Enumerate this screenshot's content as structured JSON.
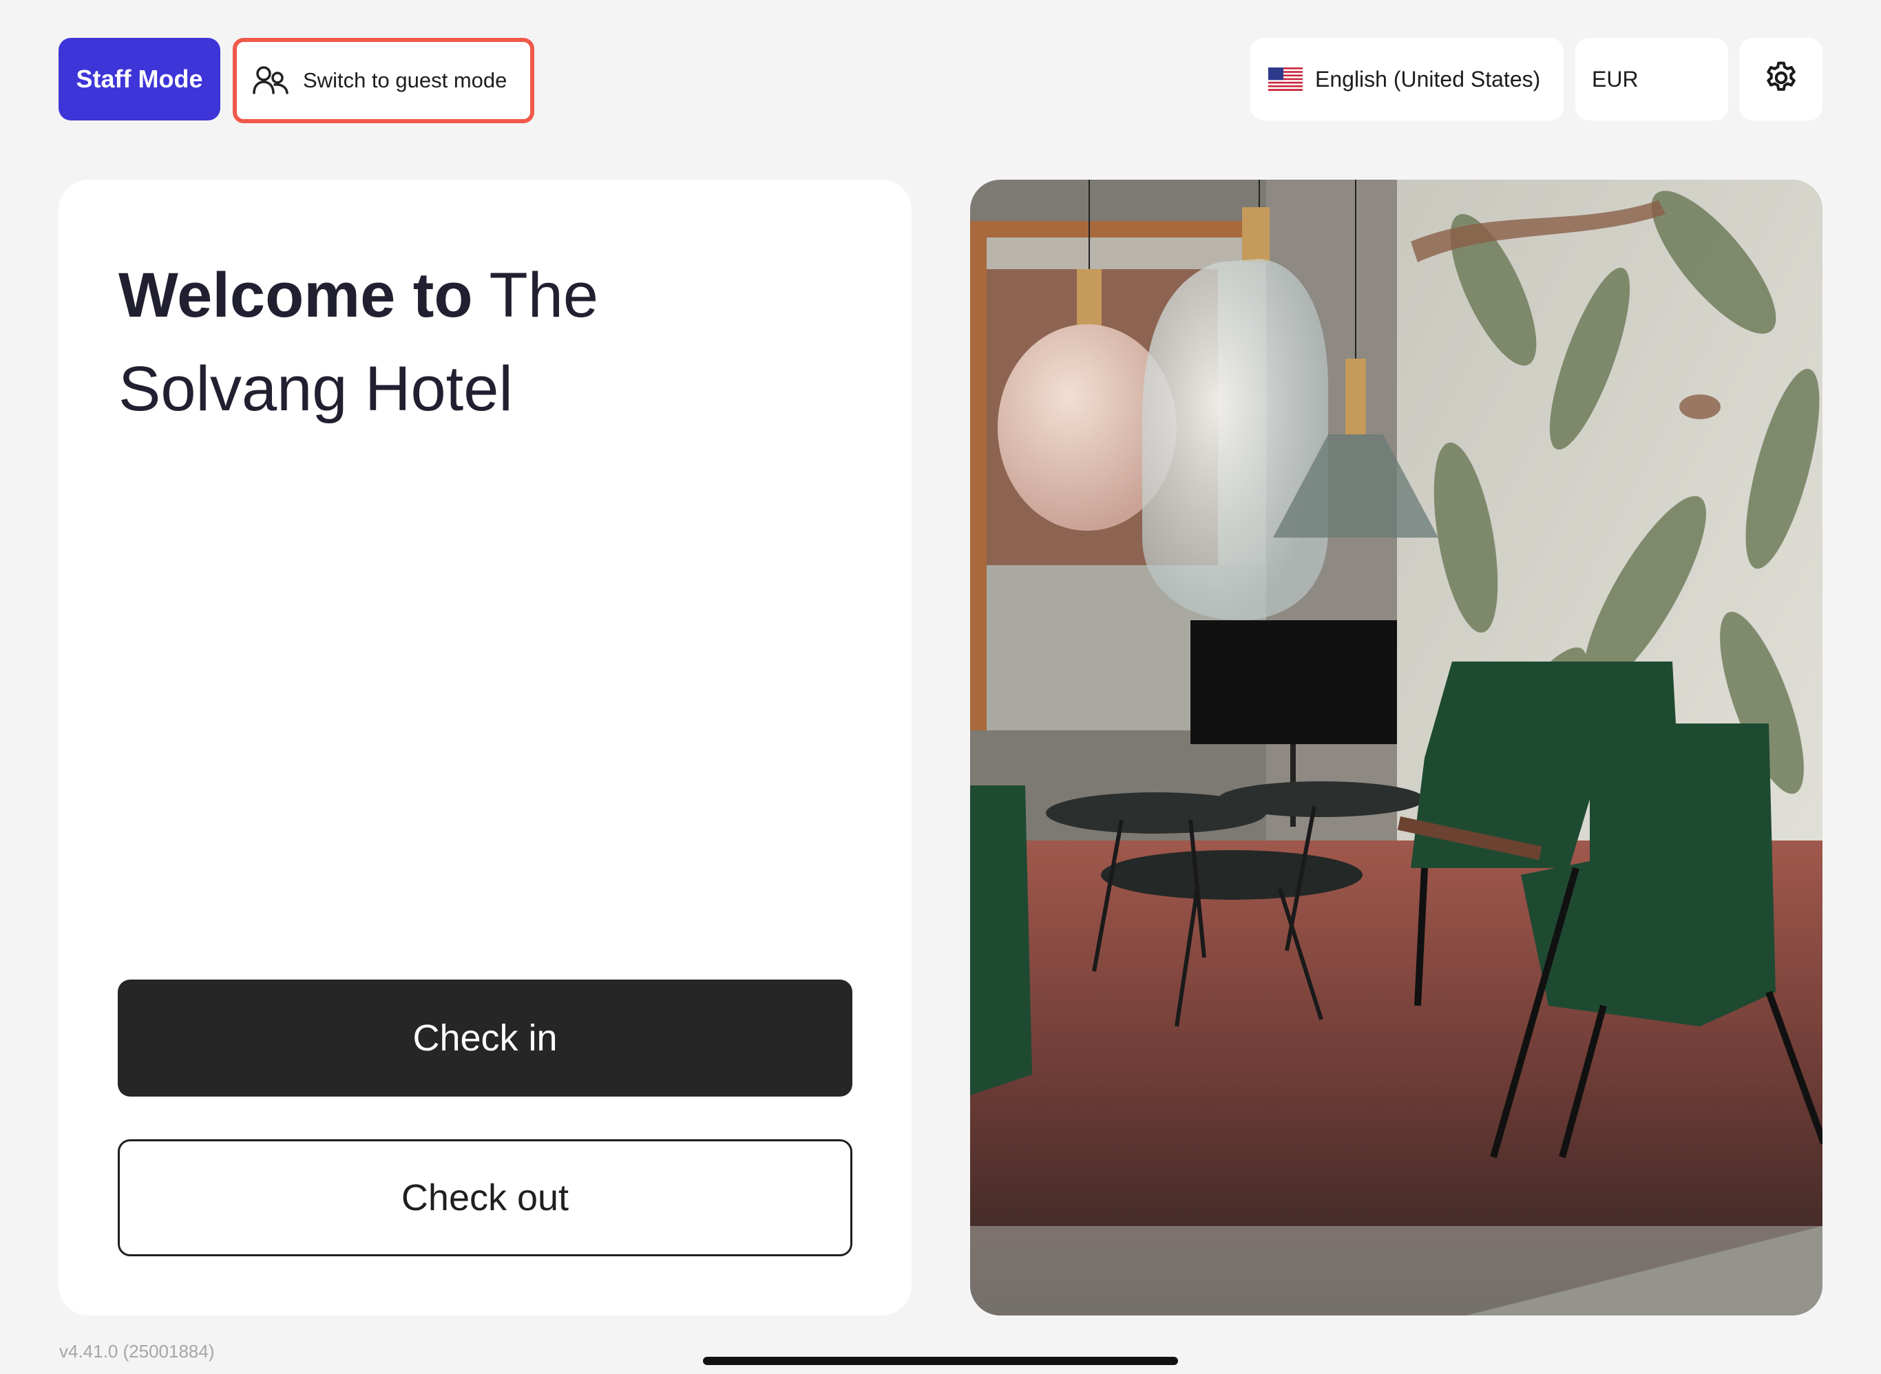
{
  "header": {
    "staff_mode_label": "Staff Mode",
    "switch_guest_label": "Switch to guest mode",
    "guest_icon": "users-icon",
    "language_label": "English (United States)",
    "language_flag": "us-flag-icon",
    "currency_label": "EUR",
    "settings_icon": "gear-icon"
  },
  "welcome": {
    "prefix": "Welcome to",
    "hotel_name": "The Solvang Hotel"
  },
  "actions": {
    "check_in_label": "Check in",
    "check_out_label": "Check out"
  },
  "footer": {
    "version": "v4.41.0 (25001884)"
  },
  "colors": {
    "accent": "#3d35d8",
    "highlight_border": "#f0594a",
    "primary_button": "#262626",
    "background": "#f4f4f4"
  }
}
